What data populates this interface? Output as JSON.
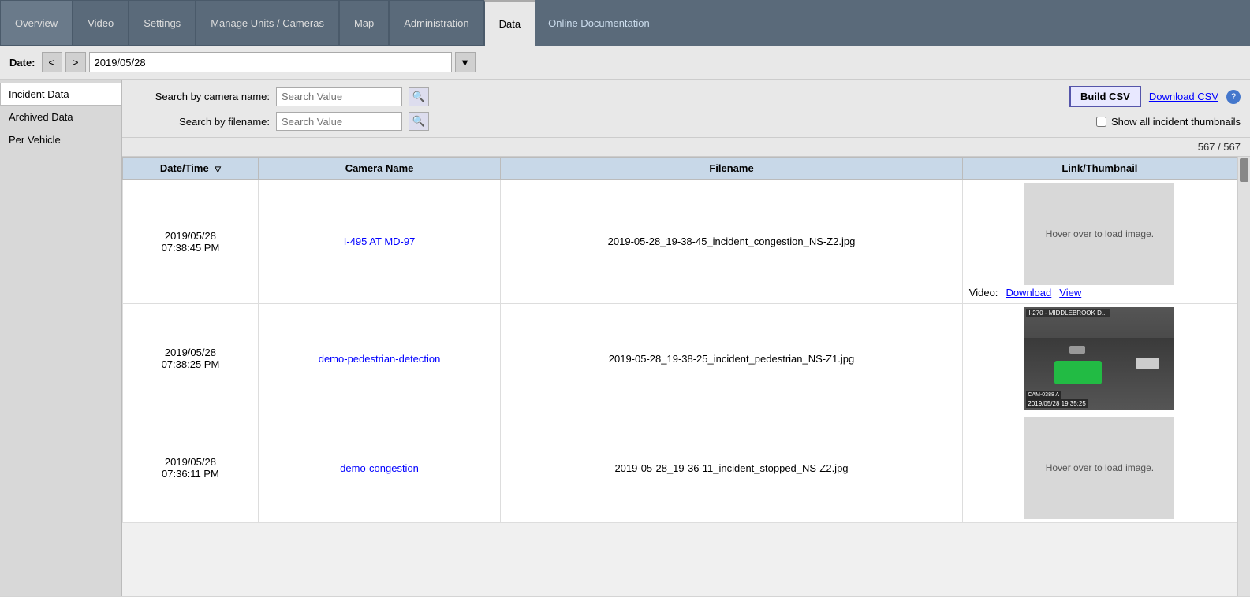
{
  "nav": {
    "tabs": [
      {
        "label": "Overview",
        "active": false
      },
      {
        "label": "Video",
        "active": false
      },
      {
        "label": "Settings",
        "active": false
      },
      {
        "label": "Manage Units / Cameras",
        "active": false
      },
      {
        "label": "Map",
        "active": false
      },
      {
        "label": "Administration",
        "active": false
      },
      {
        "label": "Data",
        "active": true
      }
    ],
    "online_doc_label": "Online Documentation"
  },
  "date_bar": {
    "label": "Date:",
    "prev_label": "<",
    "next_label": ">",
    "date_value": "2019/05/28",
    "dropdown_arrow": "▼"
  },
  "sidebar": {
    "items": [
      {
        "label": "Incident Data",
        "active": true
      },
      {
        "label": "Archived Data",
        "active": false
      },
      {
        "label": "Per Vehicle",
        "active": false
      }
    ]
  },
  "search": {
    "camera_name_label": "Search by camera name:",
    "camera_name_placeholder": "Search Value",
    "filename_label": "Search by filename:",
    "filename_placeholder": "Search Value",
    "search_icon": "🔍",
    "build_csv_label": "Build CSV",
    "download_csv_label": "Download CSV",
    "help_icon": "?",
    "show_thumbnails_label": "Show all incident thumbnails"
  },
  "count": {
    "current": 567,
    "total": 567,
    "display": "567 / 567"
  },
  "table": {
    "columns": [
      {
        "label": "Date/Time",
        "sortable": true
      },
      {
        "label": "Camera Name",
        "sortable": false
      },
      {
        "label": "Filename",
        "sortable": false
      },
      {
        "label": "Link/Thumbnail",
        "sortable": false
      }
    ],
    "rows": [
      {
        "datetime_line1": "2019/05/28",
        "datetime_line2": "07:38:45 PM",
        "camera_name": "I-495 AT MD-97",
        "filename": "2019-05-28_19-38-45_incident_congestion_NS-Z2.jpg",
        "thumbnail_type": "placeholder",
        "thumbnail_text": "Hover over to load image.",
        "has_video": true,
        "video_download_label": "Download",
        "video_view_label": "View",
        "video_prefix": "Video:"
      },
      {
        "datetime_line1": "2019/05/28",
        "datetime_line2": "07:38:25 PM",
        "camera_name": "demo-pedestrian-detection",
        "filename": "2019-05-28_19-38-25_incident_pedestrian_NS-Z1.jpg",
        "thumbnail_type": "image",
        "thumbnail_text": "",
        "has_video": false,
        "video_download_label": "",
        "video_view_label": "",
        "video_prefix": ""
      },
      {
        "datetime_line1": "2019/05/28",
        "datetime_line2": "07:36:11 PM",
        "camera_name": "demo-congestion",
        "filename": "2019-05-28_19-36-11_incident_stopped_NS-Z2.jpg",
        "thumbnail_type": "placeholder",
        "thumbnail_text": "Hover over to load image.",
        "has_video": false,
        "video_download_label": "",
        "video_view_label": "",
        "video_prefix": ""
      }
    ]
  }
}
